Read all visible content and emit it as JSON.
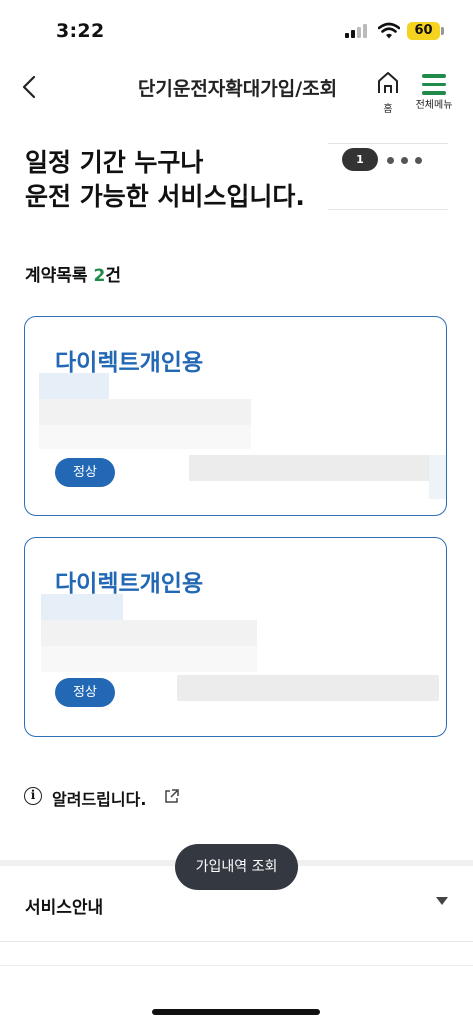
{
  "status_bar": {
    "time": "3:22",
    "battery": "60"
  },
  "header": {
    "title": "단기운전자확대가입/조회",
    "home_label": "홈",
    "menu_label": "전체메뉴"
  },
  "hero": {
    "line1": "일정 기간 누구나",
    "line2": "운전 가능한 서비스입니다.",
    "page_badge": "1"
  },
  "contracts": {
    "title_prefix": "계약목록 ",
    "count": "2",
    "title_suffix": "건",
    "items": [
      {
        "title": "다이렉트개인용",
        "status": "정상"
      },
      {
        "title": "다이렉트개인용",
        "status": "정상"
      }
    ]
  },
  "notice": {
    "label": "알려드립니다."
  },
  "tooltip": {
    "label": "가입내역 조회"
  },
  "service": {
    "label": "서비스안내"
  },
  "colors": {
    "brand_green": "#1f8a4a",
    "brand_blue": "#2268b5"
  }
}
